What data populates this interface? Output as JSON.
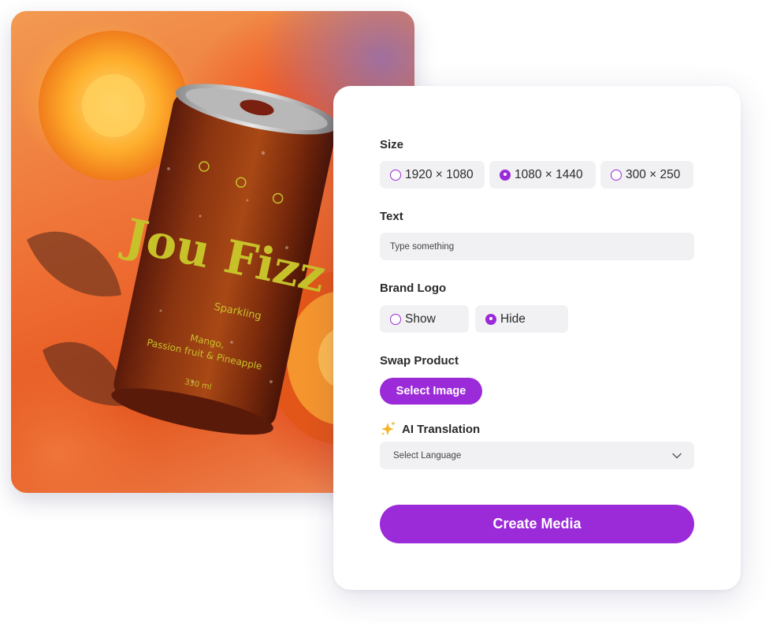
{
  "product_image": {
    "can_brand_logo": "Jou Fizz",
    "can_subtitle": "Sparkling",
    "can_flavor_line1": "Mango,",
    "can_flavor_line2": "Passion fruit & Pineapple",
    "can_volume": "330 ml"
  },
  "panel": {
    "size": {
      "label": "Size",
      "options": [
        {
          "label": "1920 × 1080",
          "selected": false
        },
        {
          "label": "1080 × 1440",
          "selected": true
        },
        {
          "label": "300 × 250",
          "selected": false
        }
      ]
    },
    "text": {
      "label": "Text",
      "placeholder": "Type something",
      "value": ""
    },
    "brand_logo": {
      "label": "Brand Logo",
      "options": [
        {
          "label": "Show",
          "selected": false
        },
        {
          "label": "Hide",
          "selected": true
        }
      ]
    },
    "swap_product": {
      "label": "Swap Product",
      "button_label": "Select Image"
    },
    "ai_translation": {
      "label": "AI Translation",
      "icon": "sparkles-icon",
      "select_value": "Select Language"
    },
    "create_button_label": "Create Media"
  },
  "colors": {
    "accent": "#9b2bd8",
    "chip_bg": "#f1f1f3",
    "sparkle": "#f5b52a"
  }
}
